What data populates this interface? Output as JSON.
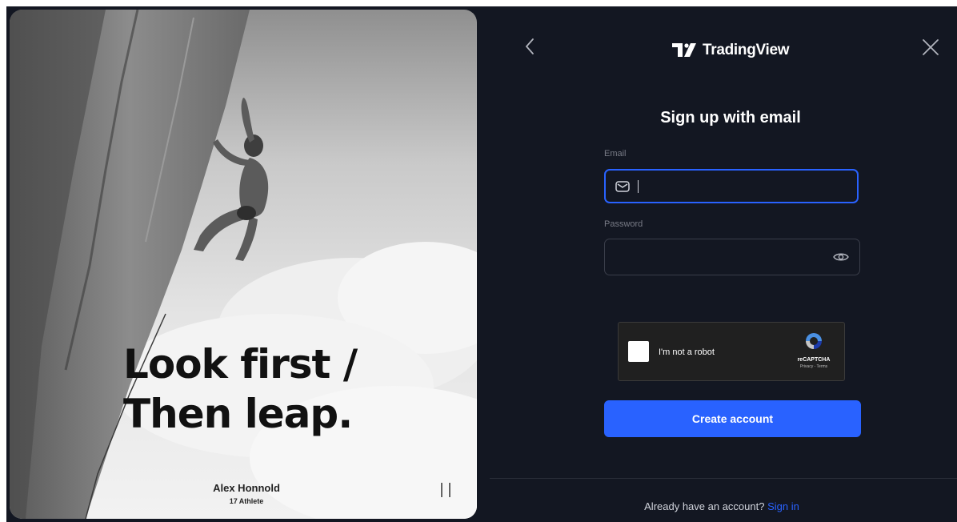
{
  "promo": {
    "headline_line1": "Look first /",
    "headline_line2": "Then leap.",
    "athlete_name": "Alex Honnold",
    "athlete_role": "Athlete",
    "brand_mark": "17"
  },
  "header": {
    "brand": "TradingView",
    "back_icon": "chevron-left-icon",
    "close_icon": "close-icon"
  },
  "form": {
    "title": "Sign up with email",
    "email_label": "Email",
    "email_value": "",
    "password_label": "Password",
    "password_value": "",
    "create_button": "Create account"
  },
  "recaptcha": {
    "label": "I'm not a robot",
    "name": "reCAPTCHA",
    "links": "Privacy - Terms"
  },
  "footer": {
    "prompt": "Already have an account?",
    "link": "Sign in"
  },
  "colors": {
    "background": "#131722",
    "accent": "#2962ff",
    "text": "#ffffff"
  }
}
